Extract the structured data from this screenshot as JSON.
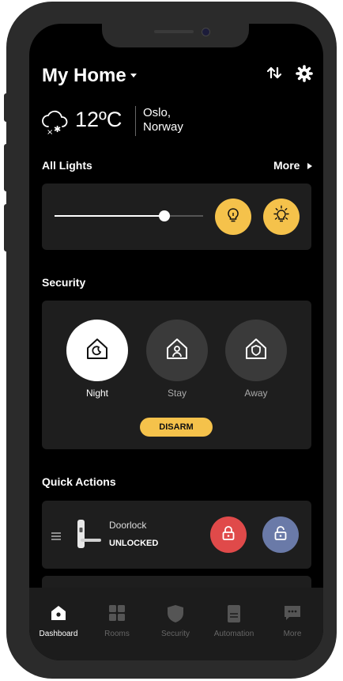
{
  "header": {
    "title": "My Home"
  },
  "weather": {
    "temperature": "12ºC",
    "city": "Oslo,",
    "country": "Norway"
  },
  "lights": {
    "section_title": "All Lights",
    "more_label": "More",
    "brightness_percent": 74
  },
  "security": {
    "section_title": "Security",
    "modes": [
      "Night",
      "Stay",
      "Away"
    ],
    "disarm_label": "DISARM"
  },
  "quick_actions": {
    "section_title": "Quick Actions",
    "device_name": "Doorlock",
    "device_status": "UNLOCKED"
  },
  "tabs": [
    "Dashboard",
    "Rooms",
    "Security",
    "Automation",
    "More"
  ],
  "colors": {
    "accent": "#f5c24b",
    "lock_red": "#e04a4a",
    "lock_blue": "#6a7aa8",
    "card": "#1e1e1e"
  }
}
